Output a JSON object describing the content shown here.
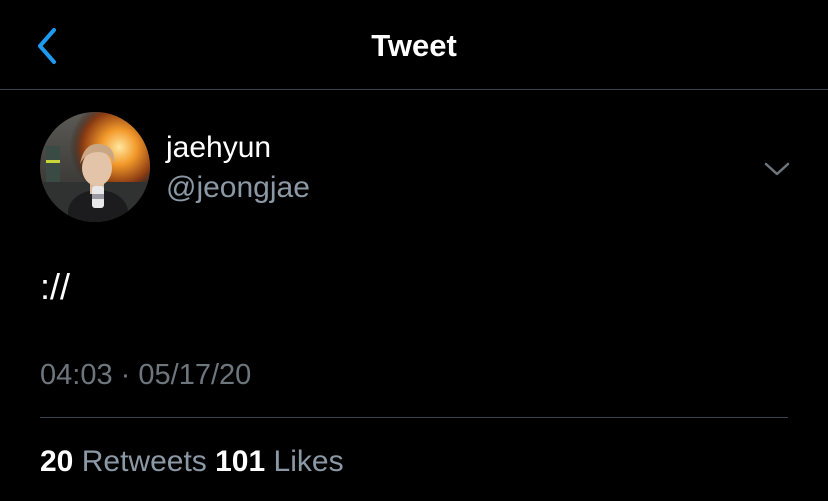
{
  "header": {
    "title": "Tweet",
    "back_icon": "chevron-left-icon"
  },
  "colors": {
    "background": "#000000",
    "accent": "#1d9bf0",
    "secondary_text": "#8b98a5",
    "divider": "#38444d"
  },
  "tweet": {
    "author": {
      "display_name": "jaehyun",
      "handle": "@jeongjae"
    },
    "more_icon": "chevron-down-icon",
    "text": "://",
    "time": "04:03",
    "separator": "·",
    "date": "05/17/20",
    "retweets": {
      "count": "20",
      "label": "Retweets"
    },
    "likes": {
      "count": "101",
      "label": "Likes"
    }
  }
}
